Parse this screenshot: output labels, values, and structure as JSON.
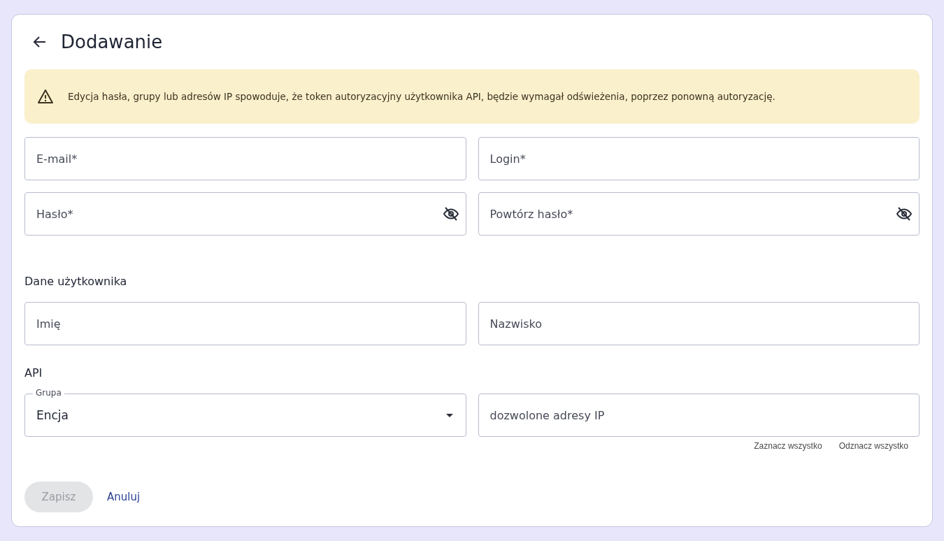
{
  "header": {
    "title": "Dodawanie"
  },
  "alert": {
    "text": "Edycja hasła, grupy lub adresów IP spowoduje, że token autoryzacyjny użytkownika API, będzie wymagał odświeżenia, poprzez ponowną autoryzację."
  },
  "account_fields": [
    {
      "kind": "text",
      "placeholder": "E-mail*"
    },
    {
      "kind": "text",
      "placeholder": "Login*"
    },
    {
      "kind": "password",
      "placeholder": "Hasło*"
    },
    {
      "kind": "password",
      "placeholder": "Powtórz hasło*"
    }
  ],
  "user_section": {
    "title": "Dane użytkownika",
    "fields": [
      {
        "kind": "text",
        "placeholder": "Imię"
      },
      {
        "kind": "text",
        "placeholder": "Nazwisko"
      }
    ]
  },
  "api_section": {
    "title": "API",
    "group": {
      "label": "Grupa",
      "value": "Encja"
    },
    "ip_field": {
      "placeholder": "dozwolone adresy IP"
    },
    "links": [
      "Zaznacz wszystko",
      "Odznacz wszystko"
    ]
  },
  "actions": {
    "save": {
      "label": "Zapisz",
      "disabled": true
    },
    "cancel": {
      "label": "Anuluj"
    }
  }
}
